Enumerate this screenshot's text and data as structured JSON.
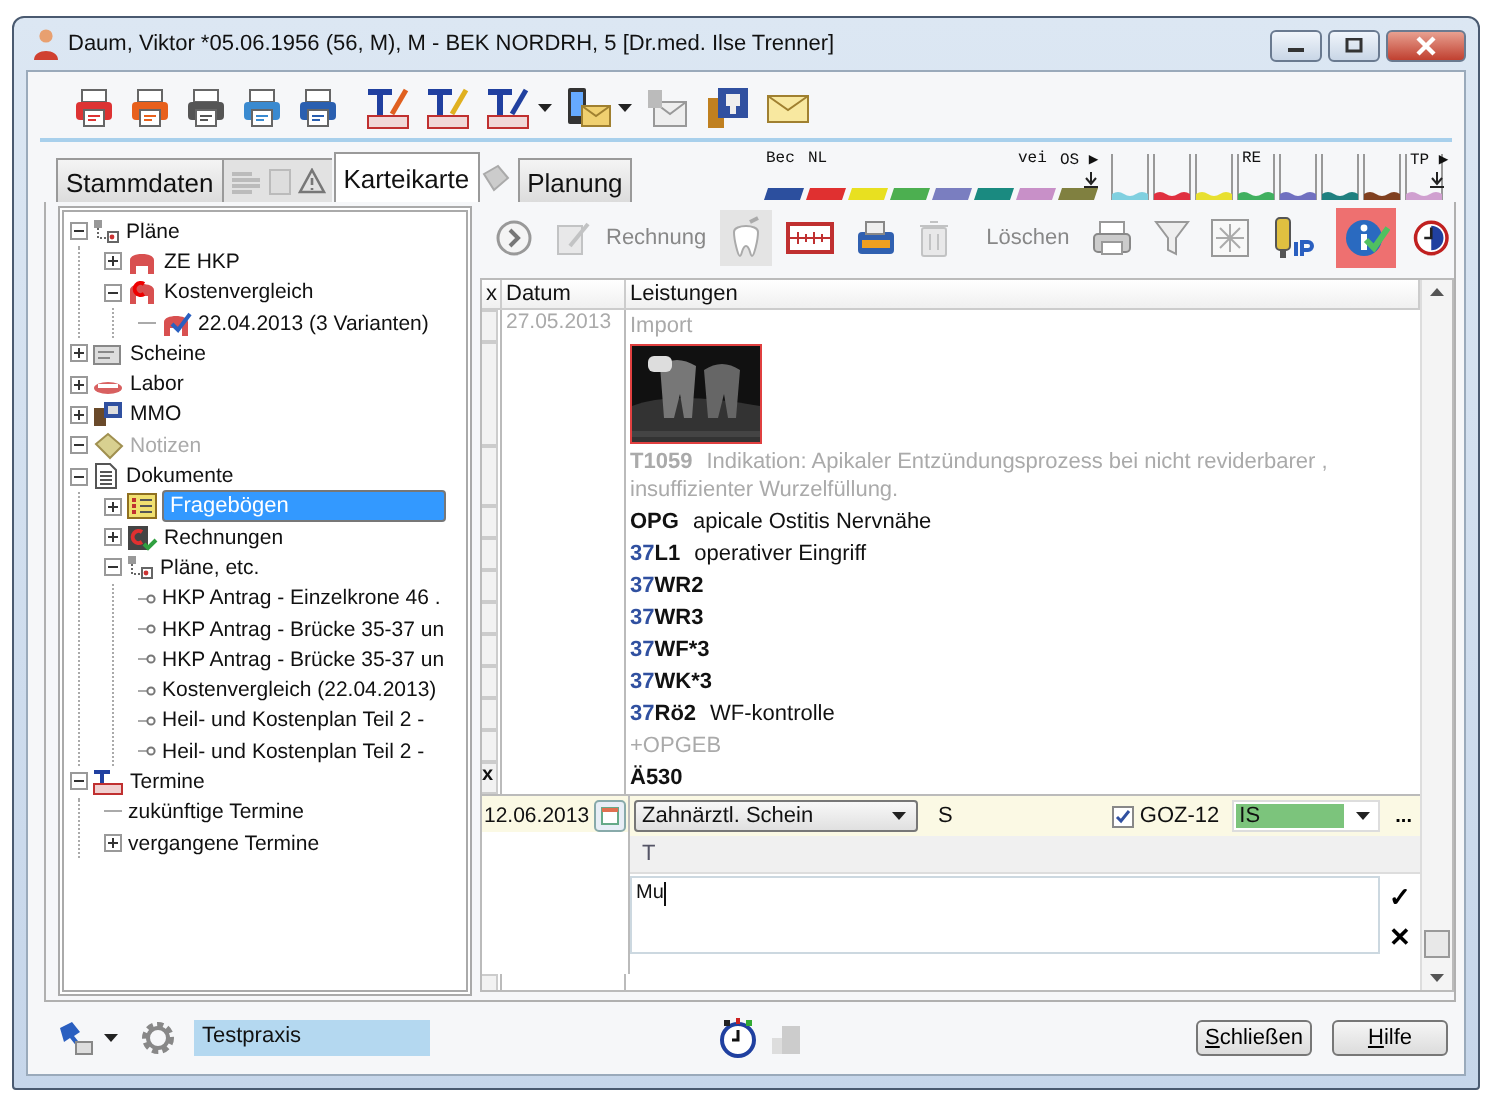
{
  "window": {
    "title": "Daum, Viktor  *05.06.1956 (56, M),  M - BEK NORDRH,  5 [Dr.med. Ilse Trenner]"
  },
  "tabs": [
    {
      "label": "Stammdaten",
      "selected": false
    },
    {
      "label": "Karteikarte",
      "selected": true
    },
    {
      "label": "Planung",
      "selected": false
    }
  ],
  "color_tabs": [
    {
      "label": "Bec",
      "color": "#2c4f9e",
      "kind": "solid"
    },
    {
      "label": "NL",
      "color": "#e03030",
      "kind": "solid"
    },
    {
      "color": "#e8e020",
      "kind": "solid"
    },
    {
      "color": "#4caf50",
      "kind": "solid"
    },
    {
      "color": "#7a7ec0",
      "kind": "solid"
    },
    {
      "color": "#1a8a80",
      "kind": "solid"
    },
    {
      "label": "vei",
      "color": "#c890c8",
      "kind": "solid"
    },
    {
      "label": "OS ▶",
      "color": "#808040",
      "kind": "solid"
    },
    {
      "color": "#80d0e0",
      "kind": "outline"
    },
    {
      "color": "#e03040",
      "kind": "outline"
    },
    {
      "color": "#e8e030",
      "kind": "outline"
    },
    {
      "label": "RE",
      "color": "#40b060",
      "kind": "outline"
    },
    {
      "color": "#7070c0",
      "kind": "outline"
    },
    {
      "color": "#208080",
      "kind": "outline"
    },
    {
      "color": "#804020",
      "kind": "outline"
    },
    {
      "label": "TP ▶",
      "color": "#d0a0d0",
      "kind": "outline"
    }
  ],
  "tree": [
    {
      "label": "Pläne",
      "expanded": true,
      "selected": false,
      "disabled": false,
      "children": [
        {
          "label": "ZE HKP",
          "expanded": false,
          "selected": false,
          "disabled": false
        },
        {
          "label": "Kostenvergleich",
          "expanded": true,
          "selected": false,
          "disabled": false,
          "children": [
            {
              "label": "22.04.2013 (3 Varianten)",
              "selected": false,
              "disabled": false
            }
          ]
        }
      ]
    },
    {
      "label": "Scheine",
      "expanded": false,
      "selected": false,
      "disabled": false
    },
    {
      "label": "Labor",
      "expanded": false,
      "selected": false,
      "disabled": false
    },
    {
      "label": "MMO",
      "expanded": false,
      "selected": false,
      "disabled": false
    },
    {
      "label": "Notizen",
      "expanded": true,
      "selected": false,
      "disabled": true
    },
    {
      "label": "Dokumente",
      "expanded": true,
      "selected": false,
      "disabled": false,
      "children": [
        {
          "label": "Fragebögen",
          "expanded": false,
          "selected": true,
          "disabled": false
        },
        {
          "label": "Rechnungen",
          "expanded": false,
          "selected": false,
          "disabled": false
        },
        {
          "label": "Pläne, etc.",
          "expanded": true,
          "selected": false,
          "disabled": false,
          "children": [
            {
              "label": "HKP Antrag - Einzelkrone  46 .",
              "selected": false,
              "disabled": false
            },
            {
              "label": "HKP Antrag - Brücke 35-37 un",
              "selected": false,
              "disabled": false
            },
            {
              "label": "HKP Antrag - Brücke 35-37 un",
              "selected": false,
              "disabled": false
            },
            {
              "label": "Kostenvergleich (22.04.2013)",
              "selected": false,
              "disabled": false
            },
            {
              "label": "Heil- und Kostenplan Teil 2 -",
              "selected": false,
              "disabled": false
            },
            {
              "label": "Heil- und Kostenplan Teil 2 -",
              "selected": false,
              "disabled": false
            }
          ]
        }
      ]
    },
    {
      "label": "Termine",
      "expanded": true,
      "selected": false,
      "disabled": false,
      "children": [
        {
          "label": "zukünftige Termine",
          "selected": false,
          "disabled": false
        },
        {
          "label": "vergangene Termine",
          "expanded": false,
          "selected": false,
          "disabled": false
        }
      ]
    }
  ],
  "record_toolbar": [
    {
      "kind": "forward",
      "pressed": false,
      "highlighted": false,
      "disabled": false
    },
    {
      "kind": "invoice",
      "label": "Rechnung",
      "pressed": false,
      "highlighted": false,
      "disabled": true
    },
    {
      "kind": "tooth",
      "pressed": true,
      "highlighted": false,
      "disabled": false
    },
    {
      "kind": "ruler",
      "pressed": false,
      "highlighted": false,
      "disabled": false
    },
    {
      "kind": "tray",
      "pressed": false,
      "highlighted": false,
      "disabled": false
    },
    {
      "kind": "trash",
      "label": "Löschen",
      "pressed": false,
      "highlighted": false,
      "disabled": true
    },
    {
      "kind": "printer",
      "pressed": false,
      "highlighted": false,
      "disabled": false
    },
    {
      "kind": "filter",
      "pressed": false,
      "highlighted": false,
      "disabled": false
    },
    {
      "kind": "star",
      "pressed": false,
      "highlighted": false,
      "disabled": false
    },
    {
      "kind": "brush",
      "pressed": false,
      "highlighted": false,
      "disabled": false
    },
    {
      "kind": "info",
      "pressed": false,
      "highlighted": true,
      "disabled": false
    }
  ],
  "table": {
    "columns": [
      "x",
      "Datum",
      "Leistungen"
    ],
    "rows": [
      {
        "date": "27.05.2013",
        "kind": "text",
        "text": "Import",
        "muted": true
      },
      {
        "kind": "picture"
      },
      {
        "kind": "text",
        "code": "T1059",
        "text": "Indikation: Apikaler Entzündungsprozess bei nicht reviderbarer , insuffizienter Wurzelfüllung.",
        "muted": true
      },
      {
        "kind": "text",
        "code": "OPG",
        "text": "apicale Ostitis Nervnähe",
        "muted": false
      },
      {
        "kind": "text",
        "tooth": "37",
        "code": "L1",
        "text": "operativer Eingriff",
        "muted": false
      },
      {
        "kind": "text",
        "tooth": "37",
        "code": "WR2",
        "muted": false
      },
      {
        "kind": "text",
        "tooth": "37",
        "code": "WR3",
        "muted": false
      },
      {
        "kind": "text",
        "tooth": "37",
        "code": "WF*3",
        "muted": false
      },
      {
        "kind": "text",
        "tooth": "37",
        "code": "WK*3",
        "muted": false
      },
      {
        "kind": "text",
        "tooth": "37",
        "code": "Rö2",
        "text": "WF-kontrolle",
        "muted": false
      },
      {
        "kind": "text",
        "text": "+OPGEB",
        "muted": true
      },
      {
        "kind": "text",
        "x": "x",
        "code": "Ä530",
        "muted": false
      }
    ]
  },
  "entry": {
    "date": "12.06.2013",
    "schein": "Zahnärztl. Schein",
    "s_label": "S",
    "goz": {
      "label": "GOZ-12",
      "checked": true
    },
    "combo": "IS",
    "more": "...",
    "t_label": "T",
    "text": "Mu",
    "confirm": "✓",
    "cancel": "✕"
  },
  "bottom": {
    "praxis": "Testpraxis",
    "buttons": [
      {
        "label": "Schließen"
      },
      {
        "label": "Hilfe"
      }
    ]
  }
}
